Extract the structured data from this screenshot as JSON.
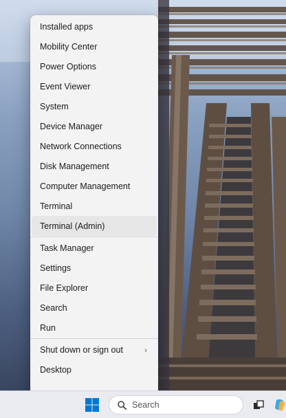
{
  "menu": {
    "items": [
      {
        "label": "Installed apps"
      },
      {
        "label": "Mobility Center"
      },
      {
        "label": "Power Options"
      },
      {
        "label": "Event Viewer"
      },
      {
        "label": "System"
      },
      {
        "label": "Device Manager"
      },
      {
        "label": "Network Connections"
      },
      {
        "label": "Disk Management"
      },
      {
        "label": "Computer Management"
      },
      {
        "label": "Terminal"
      },
      {
        "label": "Terminal (Admin)"
      },
      {
        "label": "Task Manager"
      },
      {
        "label": "Settings"
      },
      {
        "label": "File Explorer"
      },
      {
        "label": "Search"
      },
      {
        "label": "Run"
      },
      {
        "label": "Shut down or sign out"
      },
      {
        "label": "Desktop"
      }
    ],
    "submenu_indicator": "›"
  },
  "taskbar": {
    "search_label": "Search"
  },
  "colors": {
    "menu_bg": "#f3f3f3",
    "hover_bg": "#e6e6e6",
    "start_blue": "#0078d4",
    "taskbar_bg": "#e9ebef"
  }
}
